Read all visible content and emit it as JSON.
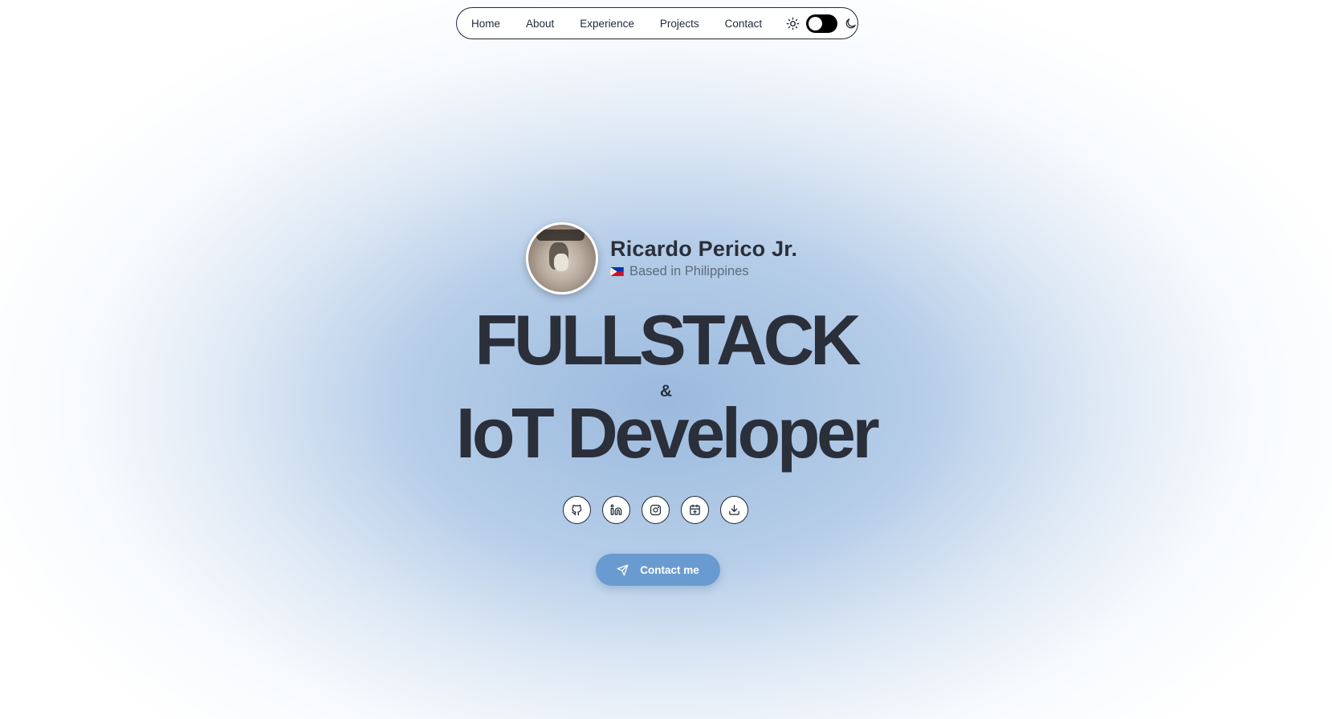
{
  "nav": {
    "links": [
      "Home",
      "About",
      "Experience",
      "Projects",
      "Contact"
    ],
    "theme_toggle": {
      "state": "light",
      "light_icon": "sun-icon",
      "dark_icon": "moon-icon"
    }
  },
  "profile": {
    "name": "Ricardo Perico Jr.",
    "location": "Based in Philippines",
    "flag_icon": "philippines-flag-icon"
  },
  "headline": {
    "line1": "FULLSTACK",
    "amp": "&",
    "line2": "IoT Developer"
  },
  "socials": [
    {
      "icon": "github-icon"
    },
    {
      "icon": "linkedin-icon"
    },
    {
      "icon": "instagram-icon"
    },
    {
      "icon": "calendar-plus-icon"
    },
    {
      "icon": "download-icon"
    }
  ],
  "cta": {
    "label": "Contact me",
    "icon": "send-icon"
  },
  "colors": {
    "text": "#2b2f3a",
    "accent": "#6a9bd0",
    "glow": "#a8c4e4"
  }
}
